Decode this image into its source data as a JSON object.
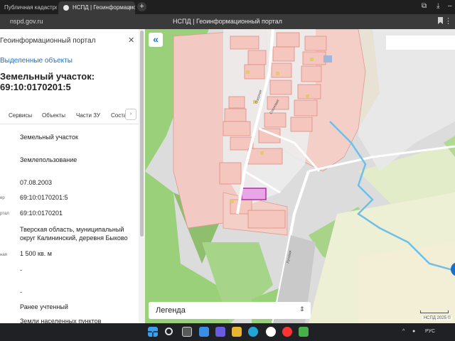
{
  "browser": {
    "tabs": [
      {
        "label": "Публичная кадастровая карта"
      },
      {
        "label": "НСПД | Геоинформационный портал"
      }
    ],
    "new_tab_label": "+",
    "url": "nspd.gov.ru",
    "page_title": "НСПД | Геоинформационный портал"
  },
  "panel": {
    "portal_label": "Геоинформационный портал",
    "selected_link": "Выделенные объекты",
    "object_title": "Земельный участок: 69:10:0170201:5",
    "tabs": [
      "Сервисы",
      "Объекты",
      "Части ЗУ",
      "Состав"
    ],
    "more_label": "›",
    "rows": [
      {
        "label": "",
        "value": "Земельный участок"
      },
      {
        "label": "",
        "value": "Землепользование"
      },
      {
        "label": "",
        "value": "07.08.2003"
      },
      {
        "label": "ер",
        "value": "69:10:0170201:5"
      },
      {
        "label": "ртал",
        "value": "69:10:0170201"
      },
      {
        "label": "",
        "value": "Тверская область, муниципальный округ Калининский, деревня Быково"
      },
      {
        "label": "ная",
        "value": "1 500 кв. м"
      },
      {
        "label": "",
        "value": "-"
      },
      {
        "label": "",
        "value": "-"
      },
      {
        "label": "",
        "value": "Ранее учтенный"
      },
      {
        "label": "",
        "value": "Земли населенных пунктов"
      }
    ]
  },
  "map": {
    "collapse_label": "«",
    "legend_label": "Легенда",
    "legend_chevron": "⌃⌄",
    "copyright": "НСПД 2025 ©",
    "street_labels": [
      "Озерная",
      "Сосновая",
      "Луговая"
    ]
  },
  "taskbar": {
    "lang": "РУС",
    "colors": {
      "windows": "#3aa0f2",
      "yandex": "#ff3333",
      "edge": "#22a6d6"
    }
  }
}
